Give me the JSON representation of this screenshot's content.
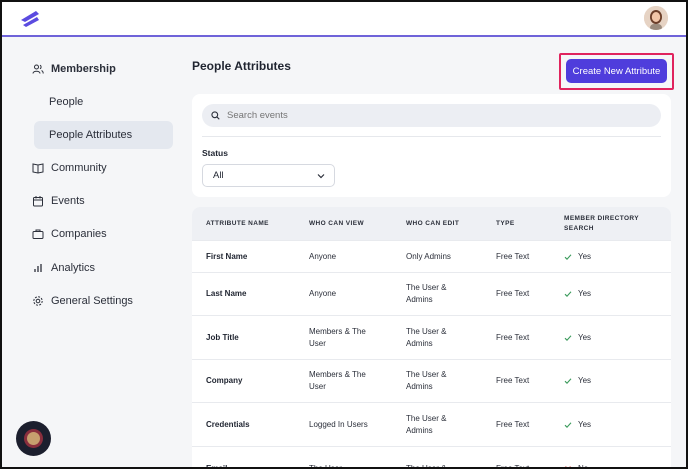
{
  "sidebar": {
    "items": [
      {
        "label": "Membership",
        "icon": "users-icon"
      },
      {
        "label": "People"
      },
      {
        "label": "People Attributes"
      },
      {
        "label": "Community",
        "icon": "book-icon"
      },
      {
        "label": "Events",
        "icon": "calendar-icon"
      },
      {
        "label": "Companies",
        "icon": "briefcase-icon"
      },
      {
        "label": "Analytics",
        "icon": "bar-chart-icon"
      },
      {
        "label": "General Settings",
        "icon": "gear-icon"
      }
    ]
  },
  "header": {
    "page_title": "People Attributes",
    "create_button": "Create New Attribute"
  },
  "filters": {
    "search_placeholder": "Search events",
    "status_label": "Status",
    "status_value": "All"
  },
  "table": {
    "columns": [
      "ATTRIBUTE NAME",
      "WHO CAN VIEW",
      "WHO CAN EDIT",
      "TYPE",
      "MEMBER DIRECTORY SEARCH"
    ],
    "rows": [
      {
        "name": "First Name",
        "view": "Anyone",
        "edit": "Only Admins",
        "type": "Free Text",
        "search": "Yes"
      },
      {
        "name": "Last Name",
        "view": "Anyone",
        "edit": "The User & Admins",
        "type": "Free Text",
        "search": "Yes"
      },
      {
        "name": "Job Title",
        "view": "Members & The User",
        "edit": "The User & Admins",
        "type": "Free Text",
        "search": "Yes"
      },
      {
        "name": "Company",
        "view": "Members & The User",
        "edit": "The User & Admins",
        "type": "Free Text",
        "search": "Yes"
      },
      {
        "name": "Credentials",
        "view": "Logged In Users",
        "edit": "The User & Admins",
        "type": "Free Text",
        "search": "Yes"
      },
      {
        "name": "Email",
        "view": "The User",
        "edit": "The User &",
        "type": "Free Text",
        "search": "No"
      }
    ]
  },
  "colors": {
    "accent": "#4f3ddc",
    "highlight_border": "#e0245e",
    "check_yes": "#3a9a5b",
    "check_no": "#d9534f"
  }
}
